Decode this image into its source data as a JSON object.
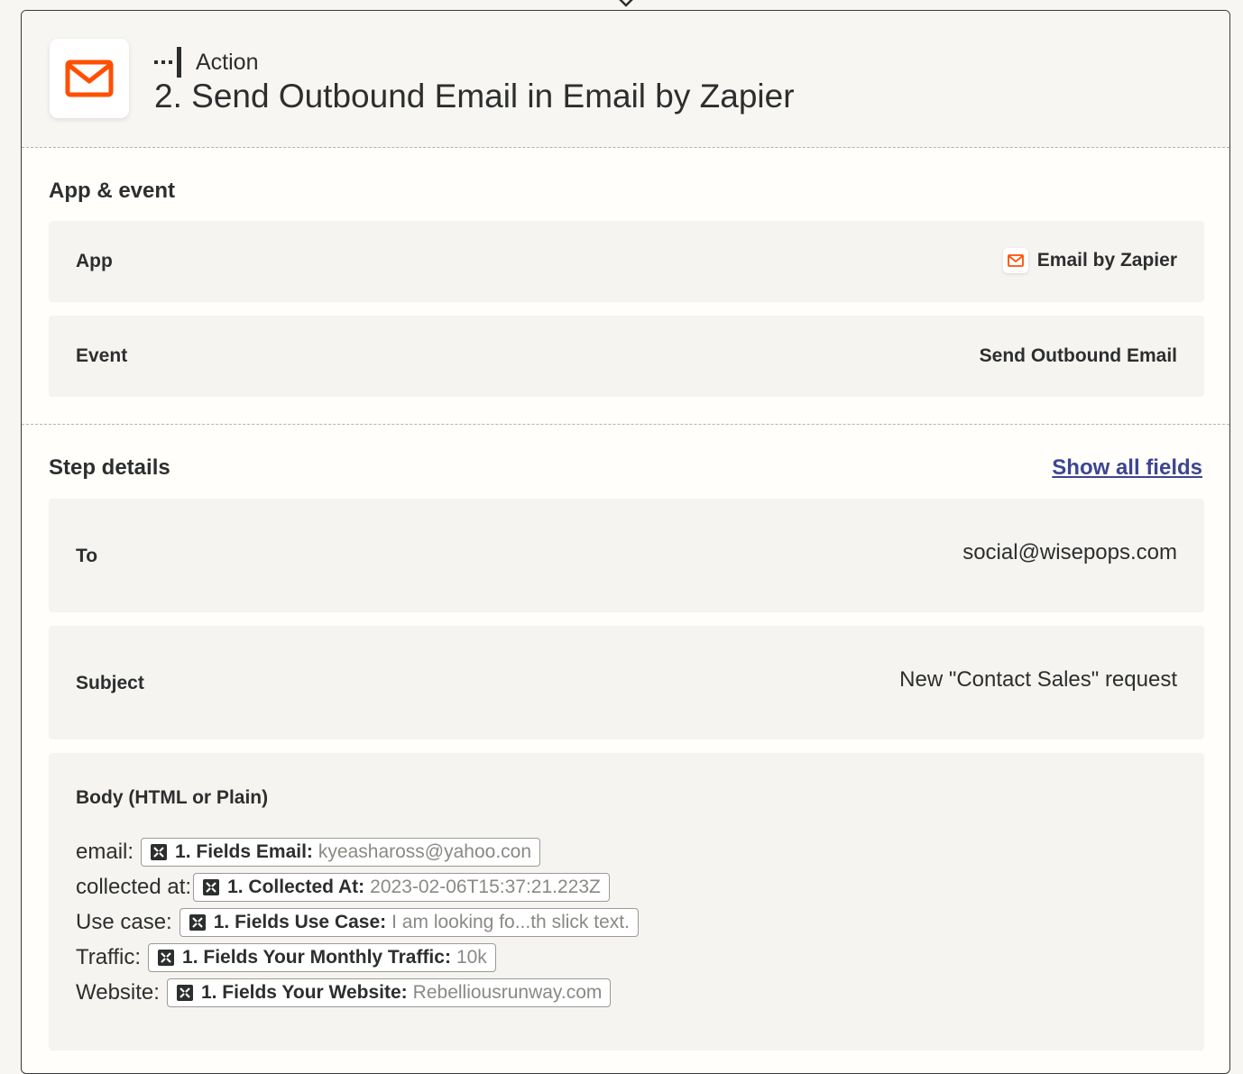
{
  "header": {
    "step_type": "Action",
    "title": "2. Send Outbound Email in Email by Zapier"
  },
  "app_event": {
    "heading": "App & event",
    "app_label": "App",
    "app_value": "Email by Zapier",
    "event_label": "Event",
    "event_value": "Send Outbound Email"
  },
  "step_details": {
    "heading": "Step details",
    "show_all_link": "Show all fields",
    "to_label": "To",
    "to_value": "social@wisepops.com",
    "subject_label": "Subject",
    "subject_value": "New \"Contact Sales\" request",
    "body_label": "Body (HTML or Plain)",
    "body_lines": [
      {
        "label": "email:",
        "field_key": "1. Fields Email:",
        "field_value": "kyeashaross@yahoo.con"
      },
      {
        "label": "collected at:",
        "field_key": "1. Collected At:",
        "field_value": "2023-02-06T15:37:21.223Z"
      },
      {
        "label": "Use case:",
        "field_key": "1. Fields Use Case:",
        "field_value": "I am looking fo...th slick text."
      },
      {
        "label": "Traffic:",
        "field_key": "1. Fields Your Monthly Traffic:",
        "field_value": "10k"
      },
      {
        "label": "Website:",
        "field_key": "1. Fields Your Website:",
        "field_value": "Rebelliousrunway.com"
      }
    ]
  },
  "colors": {
    "brand_orange": "#ff4f00",
    "link": "#3d4592",
    "card_bg": "#fffefb",
    "row_bg": "#f5f4f1"
  }
}
